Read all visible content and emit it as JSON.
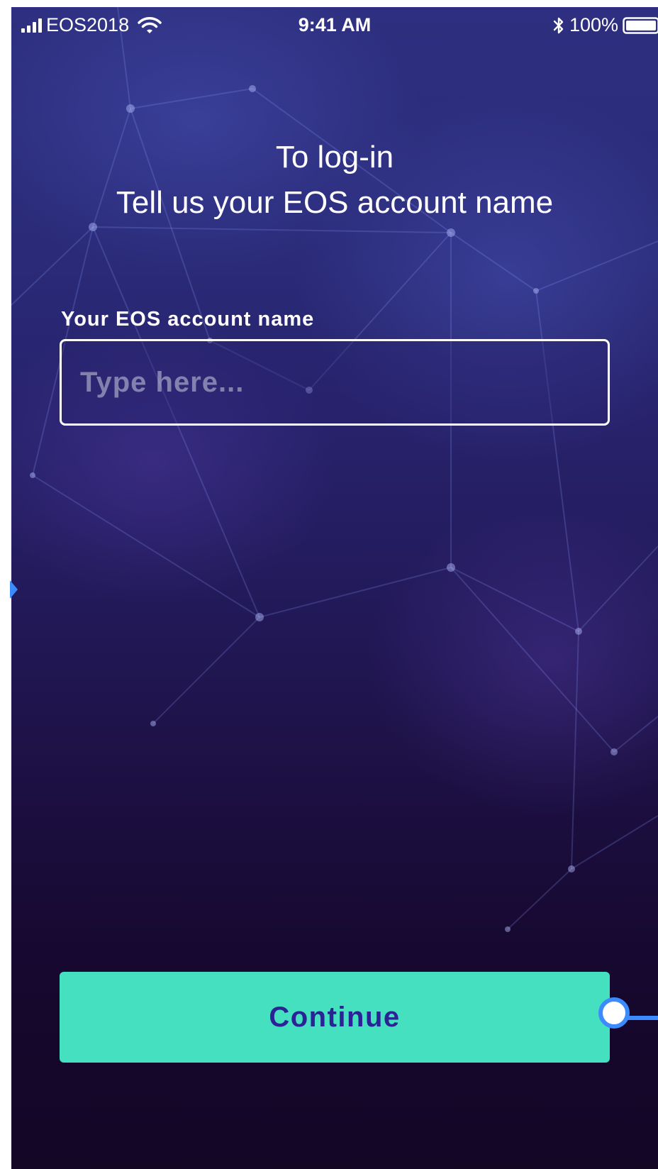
{
  "status_bar": {
    "carrier": "EOS2018",
    "time": "9:41 AM",
    "battery_percent": "100%",
    "icons": [
      "signal-bars-icon",
      "wifi-icon",
      "bluetooth-icon",
      "battery-icon"
    ]
  },
  "login": {
    "heading_line1": "To log-in",
    "heading_line2": "Tell us your EOS account name",
    "account_field_label": "Your EOS account name",
    "account_field_placeholder": "Type here...",
    "account_field_value": "",
    "continue_label": "Continue"
  },
  "colors": {
    "background_top": "#2e2f80",
    "background_bottom": "#140625",
    "button_background": "#45e0c0",
    "button_text": "#2b2296",
    "prototype_link": "#3b8bff"
  }
}
